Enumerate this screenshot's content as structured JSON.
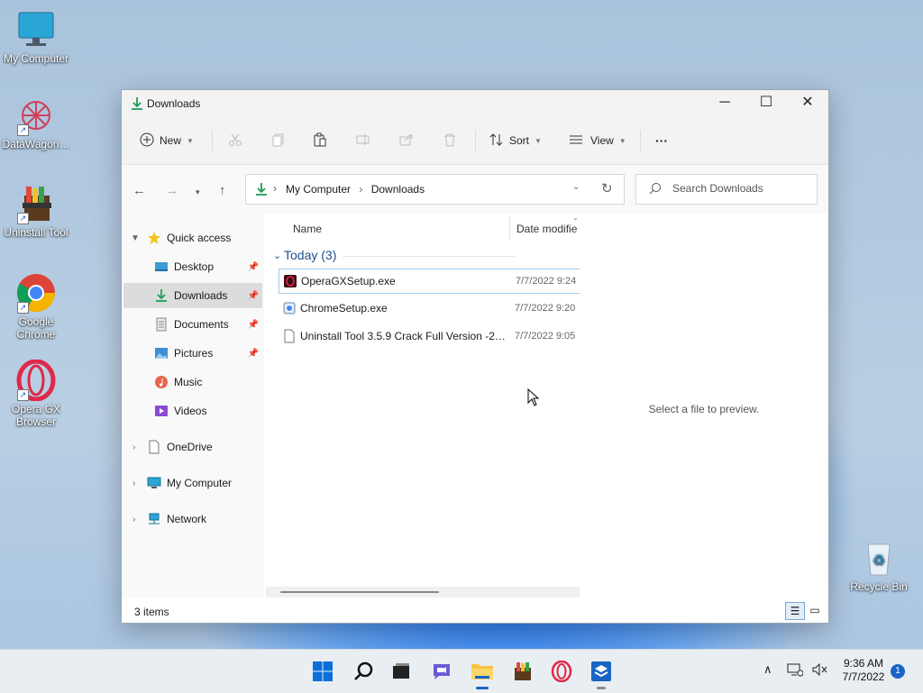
{
  "desktop": {
    "icons": [
      {
        "label": "My Computer"
      },
      {
        "label": "DataWagon…"
      },
      {
        "label": "Uninstall Tool"
      },
      {
        "label": "Google Chrome"
      },
      {
        "label": "Opera GX Browser"
      },
      {
        "label": "Recycle Bin"
      }
    ]
  },
  "window": {
    "title": "Downloads",
    "controls": {
      "minimize": "─",
      "maximize": "☐",
      "close": "✕"
    }
  },
  "toolbar": {
    "new_label": "New",
    "sort_label": "Sort",
    "view_label": "View",
    "more_label": "···"
  },
  "address": {
    "crumbs": [
      "My Computer",
      "Downloads"
    ],
    "separator": "›"
  },
  "search": {
    "placeholder": "Search Downloads"
  },
  "sidebar": {
    "quick_access": "Quick access",
    "items": [
      {
        "label": "Desktop",
        "pinned": true
      },
      {
        "label": "Downloads",
        "pinned": true,
        "selected": true
      },
      {
        "label": "Documents",
        "pinned": true
      },
      {
        "label": "Pictures",
        "pinned": true
      },
      {
        "label": "Music"
      },
      {
        "label": "Videos"
      }
    ],
    "onedrive": "OneDrive",
    "mycomputer": "My Computer",
    "network": "Network"
  },
  "files": {
    "columns": {
      "name": "Name",
      "date": "Date modifie"
    },
    "group": "Today (3)",
    "rows": [
      {
        "name": "OperaGXSetup.exe",
        "date": "7/7/2022 9:24"
      },
      {
        "name": "ChromeSetup.exe",
        "date": "7/7/2022 9:20"
      },
      {
        "name": "Uninstall Tool 3.5.9  Crack Full Version -20...",
        "date": "7/7/2022 9:05"
      }
    ]
  },
  "preview": {
    "message": "Select a file to preview."
  },
  "status": {
    "count": "3 items"
  },
  "taskbar": {
    "time": "9:36 AM",
    "date": "7/7/2022",
    "notifications": "1"
  },
  "colors": {
    "accent": "#0067c0",
    "folder_green": "#1f9d55",
    "selection": "#dcdcdc"
  }
}
